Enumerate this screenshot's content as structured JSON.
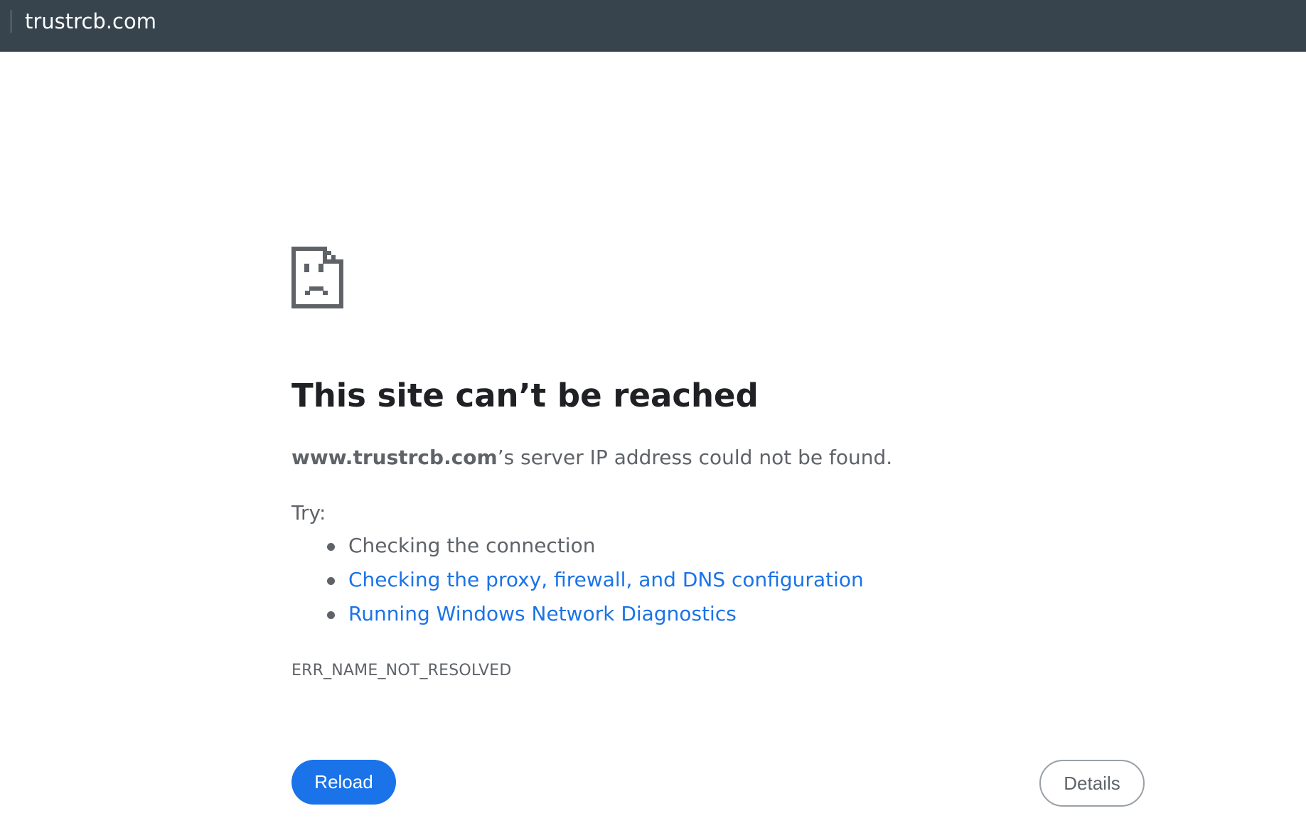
{
  "address_bar": {
    "url": "trustrcb.com"
  },
  "error_page": {
    "icon": "sad-page-icon",
    "headline": "This site can’t be reached",
    "summary_host": "www.trustrcb.com",
    "summary_rest": "’s server IP address could not be found.",
    "try_label": "Try:",
    "suggestions": [
      {
        "text": "Checking the connection",
        "is_link": false
      },
      {
        "text": "Checking the proxy, firewall, and DNS configuration",
        "is_link": true
      },
      {
        "text": "Running Windows Network Diagnostics",
        "is_link": true
      }
    ],
    "error_code": "ERR_NAME_NOT_RESOLVED",
    "reload_label": "Reload",
    "details_label": "Details"
  },
  "colors": {
    "address_bar_bg": "#37444e",
    "link": "#1a73e8",
    "primary_button": "#1a73e8",
    "body_text": "#5f6368",
    "headline_text": "#202124"
  }
}
